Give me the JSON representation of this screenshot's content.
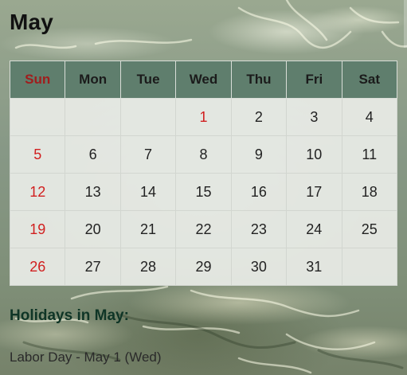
{
  "month_title": "May",
  "weekday_headers": [
    "Sun",
    "Mon",
    "Tue",
    "Wed",
    "Thu",
    "Fri",
    "Sat"
  ],
  "weeks": [
    [
      "",
      "",
      "",
      "1",
      "2",
      "3",
      "4"
    ],
    [
      "5",
      "6",
      "7",
      "8",
      "9",
      "10",
      "11"
    ],
    [
      "12",
      "13",
      "14",
      "15",
      "16",
      "17",
      "18"
    ],
    [
      "19",
      "20",
      "21",
      "22",
      "23",
      "24",
      "25"
    ],
    [
      "26",
      "27",
      "28",
      "29",
      "30",
      "31",
      ""
    ]
  ],
  "holiday_dates": [
    "1"
  ],
  "holidays": {
    "title": "Holidays in May:",
    "items": [
      "Labor Day - May 1 (Wed)"
    ]
  },
  "colors": {
    "header_bg": "#5f7e6d",
    "sunday_header": "#a01d1d",
    "sunday_date": "#d11f1f",
    "holiday_date": "#d11f1f",
    "holidays_title": "#0f3526"
  }
}
